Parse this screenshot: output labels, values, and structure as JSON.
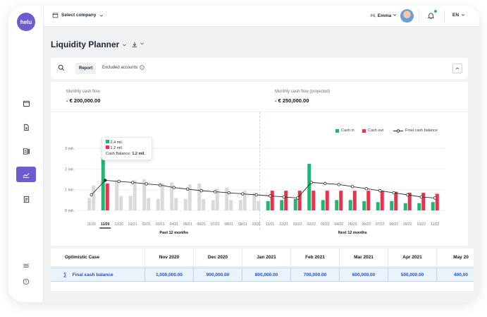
{
  "app": {
    "logo_text": "helu"
  },
  "sidebar": {
    "items": [
      {
        "icon": "wallet-icon"
      },
      {
        "icon": "document-icon"
      },
      {
        "icon": "ledger-icon"
      },
      {
        "icon": "chart-icon",
        "active": true
      },
      {
        "icon": "invoice-icon"
      }
    ],
    "bottom": [
      {
        "icon": "stack-icon"
      },
      {
        "icon": "help-icon",
        "glyph": "?"
      }
    ]
  },
  "header": {
    "company_label": "Select company",
    "greeting_prefix": "Hi,",
    "user_name": "Emma",
    "language": "EN"
  },
  "page": {
    "title": "Liquidity Planner"
  },
  "filters": {
    "report_tab": "Report",
    "excluded_accounts": "Excluded accounts",
    "info_glyph": "i"
  },
  "metrics": {
    "left_label": "Monthly cash flow",
    "left_value": "- € 200,000.00",
    "right_label": "Monthly cash flow (projected)",
    "right_value": "- € 250,000.00"
  },
  "legend": {
    "cash_in": "Cash in",
    "cash_out": "Cash out",
    "balance": "Final cash balance"
  },
  "tooltip": {
    "cash_in": "2.4 mil.",
    "cash_out": "1.2 mil.",
    "balance_label": "Cash Balance:",
    "balance_value": "1.2 mil."
  },
  "chart_data": {
    "type": "bar",
    "categories": [
      "11/20",
      "11/20",
      "12/20",
      "01/21",
      "02/21",
      "03/21",
      "04/21",
      "05/21",
      "06/21",
      "07/21",
      "08/21",
      "09/21",
      "10/21",
      "11/21",
      "12/21",
      "01/22",
      "02/22",
      "03/22",
      "04/22",
      "05/22",
      "06/22",
      "07/22",
      "08/22",
      "09/22",
      "10/22",
      "11/22"
    ],
    "selected_index": 1,
    "projected_from_index": 13,
    "group_labels": [
      "Past 12 months",
      "Next 12 months"
    ],
    "y_ticks": [
      "3 mil.",
      "2 mil.",
      "1 mil.",
      "0 mil."
    ],
    "ylim": [
      0,
      3
    ],
    "colors": {
      "cash_in": "#22b573",
      "cash_out": "#e8334f",
      "past": "#d8dadd",
      "line": "#2b2b2b"
    },
    "series": [
      {
        "name": "Cash in",
        "values": [
          0.6,
          2.55,
          1.45,
          0.7,
          1.5,
          0.55,
          1.35,
          0.55,
          1.3,
          0.5,
          1.1,
          0.5,
          0.85,
          0.45,
          0.5,
          0.55,
          2.25,
          0.5,
          0.5,
          0.5,
          0.45,
          0.4,
          0.45,
          0.35,
          0.35,
          0.4
        ]
      },
      {
        "name": "Cash out",
        "values": [
          1.2,
          1.3,
          0.7,
          1.45,
          0.6,
          1.3,
          0.6,
          1.25,
          0.55,
          1.05,
          0.5,
          0.95,
          0.45,
          0.95,
          0.95,
          0.95,
          0.95,
          0.95,
          0.95,
          0.95,
          0.95,
          0.95,
          0.9,
          0.85,
          0.85,
          0.8
        ]
      },
      {
        "name": "Final cash balance",
        "values": [
          0.75,
          1.45,
          1.4,
          1.35,
          1.28,
          1.22,
          1.1,
          1.03,
          0.95,
          0.9,
          0.85,
          0.8,
          0.75,
          0.7,
          0.65,
          0.6,
          1.35,
          1.3,
          1.25,
          1.15,
          1.05,
          0.95,
          0.85,
          0.75,
          0.65,
          0.6
        ]
      }
    ]
  },
  "table": {
    "scenario": "Optimistic Case",
    "row_label": "Final cash balance",
    "sigma": "∑",
    "columns": [
      "Nov 2020",
      "Dec 2020",
      "Jan 2021",
      "Feb 2021",
      "Mar 2021",
      "Apr 2021",
      "May 20"
    ],
    "values": [
      "1,000,000.00",
      "900,000.00",
      "800,000.00",
      "700,000.00",
      "600,000.00",
      "500,000.00",
      "400,00"
    ]
  }
}
